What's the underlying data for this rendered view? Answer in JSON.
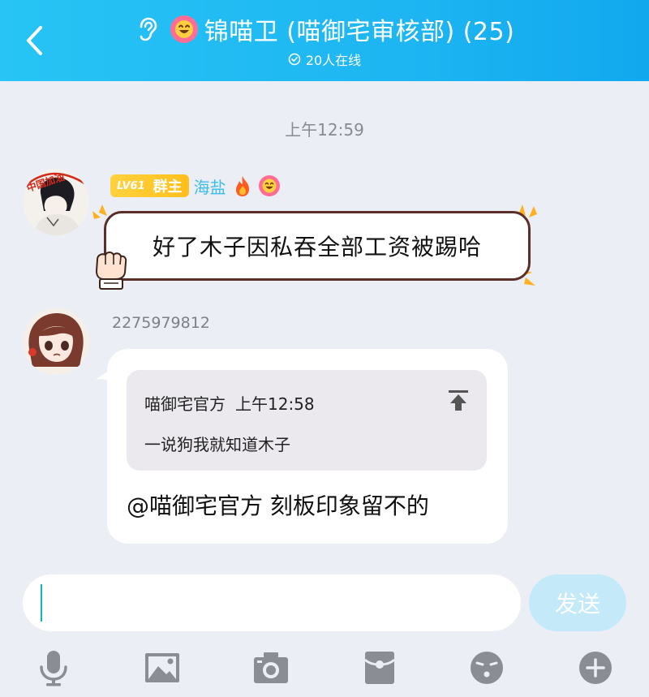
{
  "header": {
    "title": "锦喵卫 (喵御宅审核部) (25)",
    "online_status": "20人在线",
    "background": "#1eb6f2"
  },
  "chat": {
    "timestamp": "上午12:59",
    "messages": [
      {
        "level_badge": "LV61",
        "role_badge": "群主",
        "sender": "海盐",
        "avatar_caption": "中国加油",
        "text": "好了木子因私吞全部工资被踢哈"
      },
      {
        "sender": "2275979812",
        "quote": {
          "author": "喵御宅官方",
          "time": "上午12:58",
          "text": "一说狗我就知道木子"
        },
        "text": "@喵御宅官方 刻板印象留不的"
      }
    ]
  },
  "input": {
    "value": "",
    "send_label": "发送"
  },
  "toolbar": {
    "icons": [
      "microphone-icon",
      "image-icon",
      "camera-icon",
      "red-packet-icon",
      "emoji-icon",
      "plus-icon"
    ]
  },
  "colors": {
    "accent": "#1eb6f2",
    "level_badge": "#ffc728",
    "pink": "#ff6d95",
    "send_disabled": "#c4e9f8",
    "background": "#eceef5"
  }
}
